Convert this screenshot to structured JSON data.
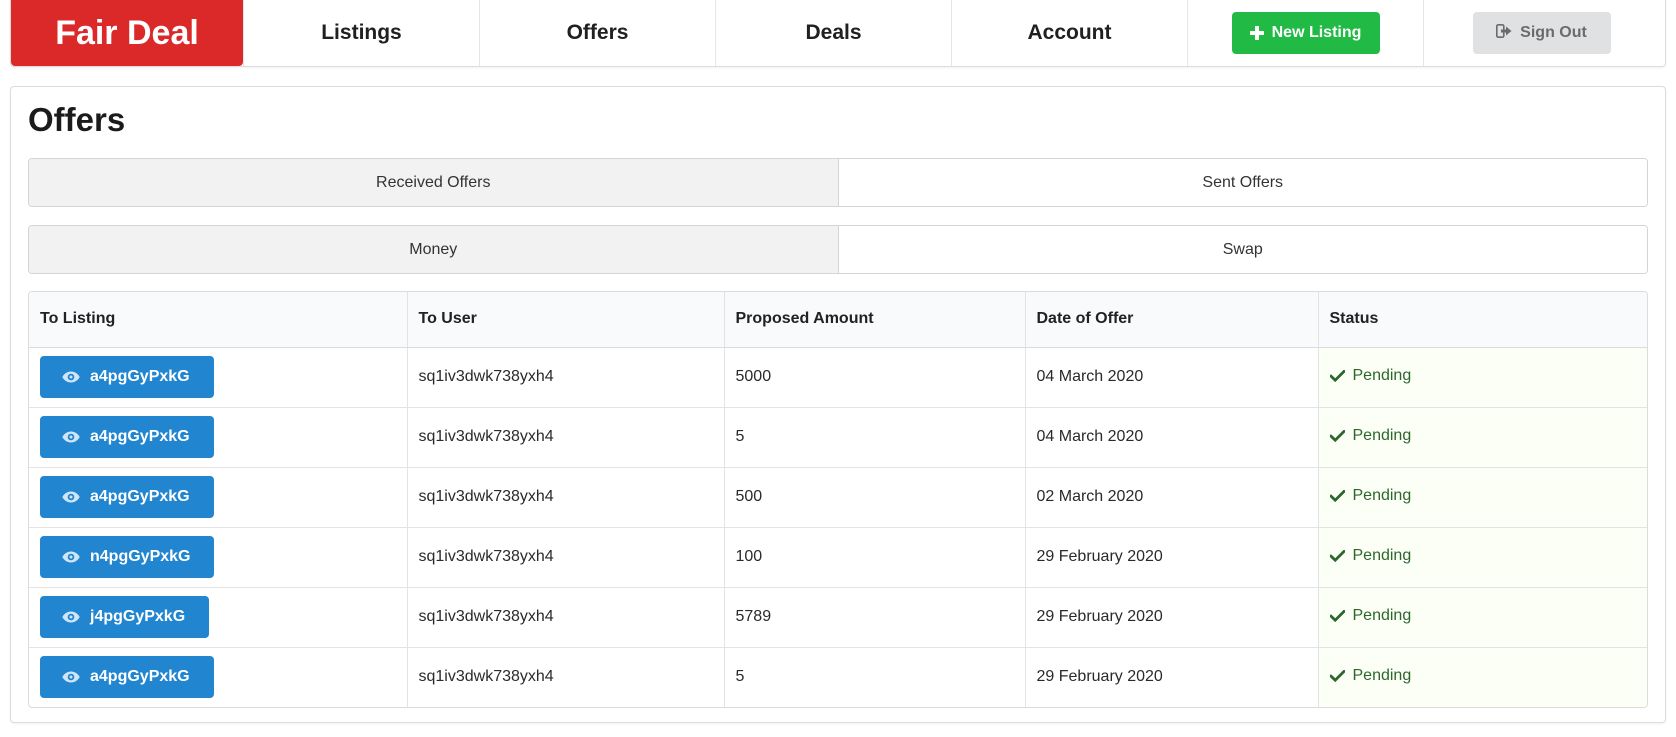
{
  "nav": {
    "brand": "Fair Deal",
    "items": [
      "Listings",
      "Offers",
      "Deals",
      "Account"
    ],
    "new_listing_label": "New Listing",
    "sign_out_label": "Sign Out"
  },
  "page": {
    "title": "Offers",
    "direction_tabs": [
      "Received Offers",
      "Sent Offers"
    ],
    "type_tabs": [
      "Money",
      "Swap"
    ]
  },
  "table": {
    "headers": [
      "To Listing",
      "To User",
      "Proposed Amount",
      "Date of Offer",
      "Status"
    ],
    "rows": [
      {
        "listing": "a4pgGyPxkG",
        "user": "sq1iv3dwk738yxh4",
        "amount": "5000",
        "date": "04 March 2020",
        "status": "Pending"
      },
      {
        "listing": "a4pgGyPxkG",
        "user": "sq1iv3dwk738yxh4",
        "amount": "5",
        "date": "04 March 2020",
        "status": "Pending"
      },
      {
        "listing": "a4pgGyPxkG",
        "user": "sq1iv3dwk738yxh4",
        "amount": "500",
        "date": "02 March 2020",
        "status": "Pending"
      },
      {
        "listing": "n4pgGyPxkG",
        "user": "sq1iv3dwk738yxh4",
        "amount": "100",
        "date": "29 February 2020",
        "status": "Pending"
      },
      {
        "listing": "j4pgGyPxkG",
        "user": "sq1iv3dwk738yxh4",
        "amount": "5789",
        "date": "29 February 2020",
        "status": "Pending"
      },
      {
        "listing": "a4pgGyPxkG",
        "user": "sq1iv3dwk738yxh4",
        "amount": "5",
        "date": "29 February 2020",
        "status": "Pending"
      }
    ]
  },
  "colors": {
    "brand": "#db2828",
    "primary": "#2185d0",
    "positive": "#21ba45",
    "status_text": "#2c662d"
  },
  "icons": {
    "new_listing": "plus-icon",
    "sign_out": "sign-out-icon",
    "listing_button": "eye-icon",
    "status": "check-icon"
  }
}
